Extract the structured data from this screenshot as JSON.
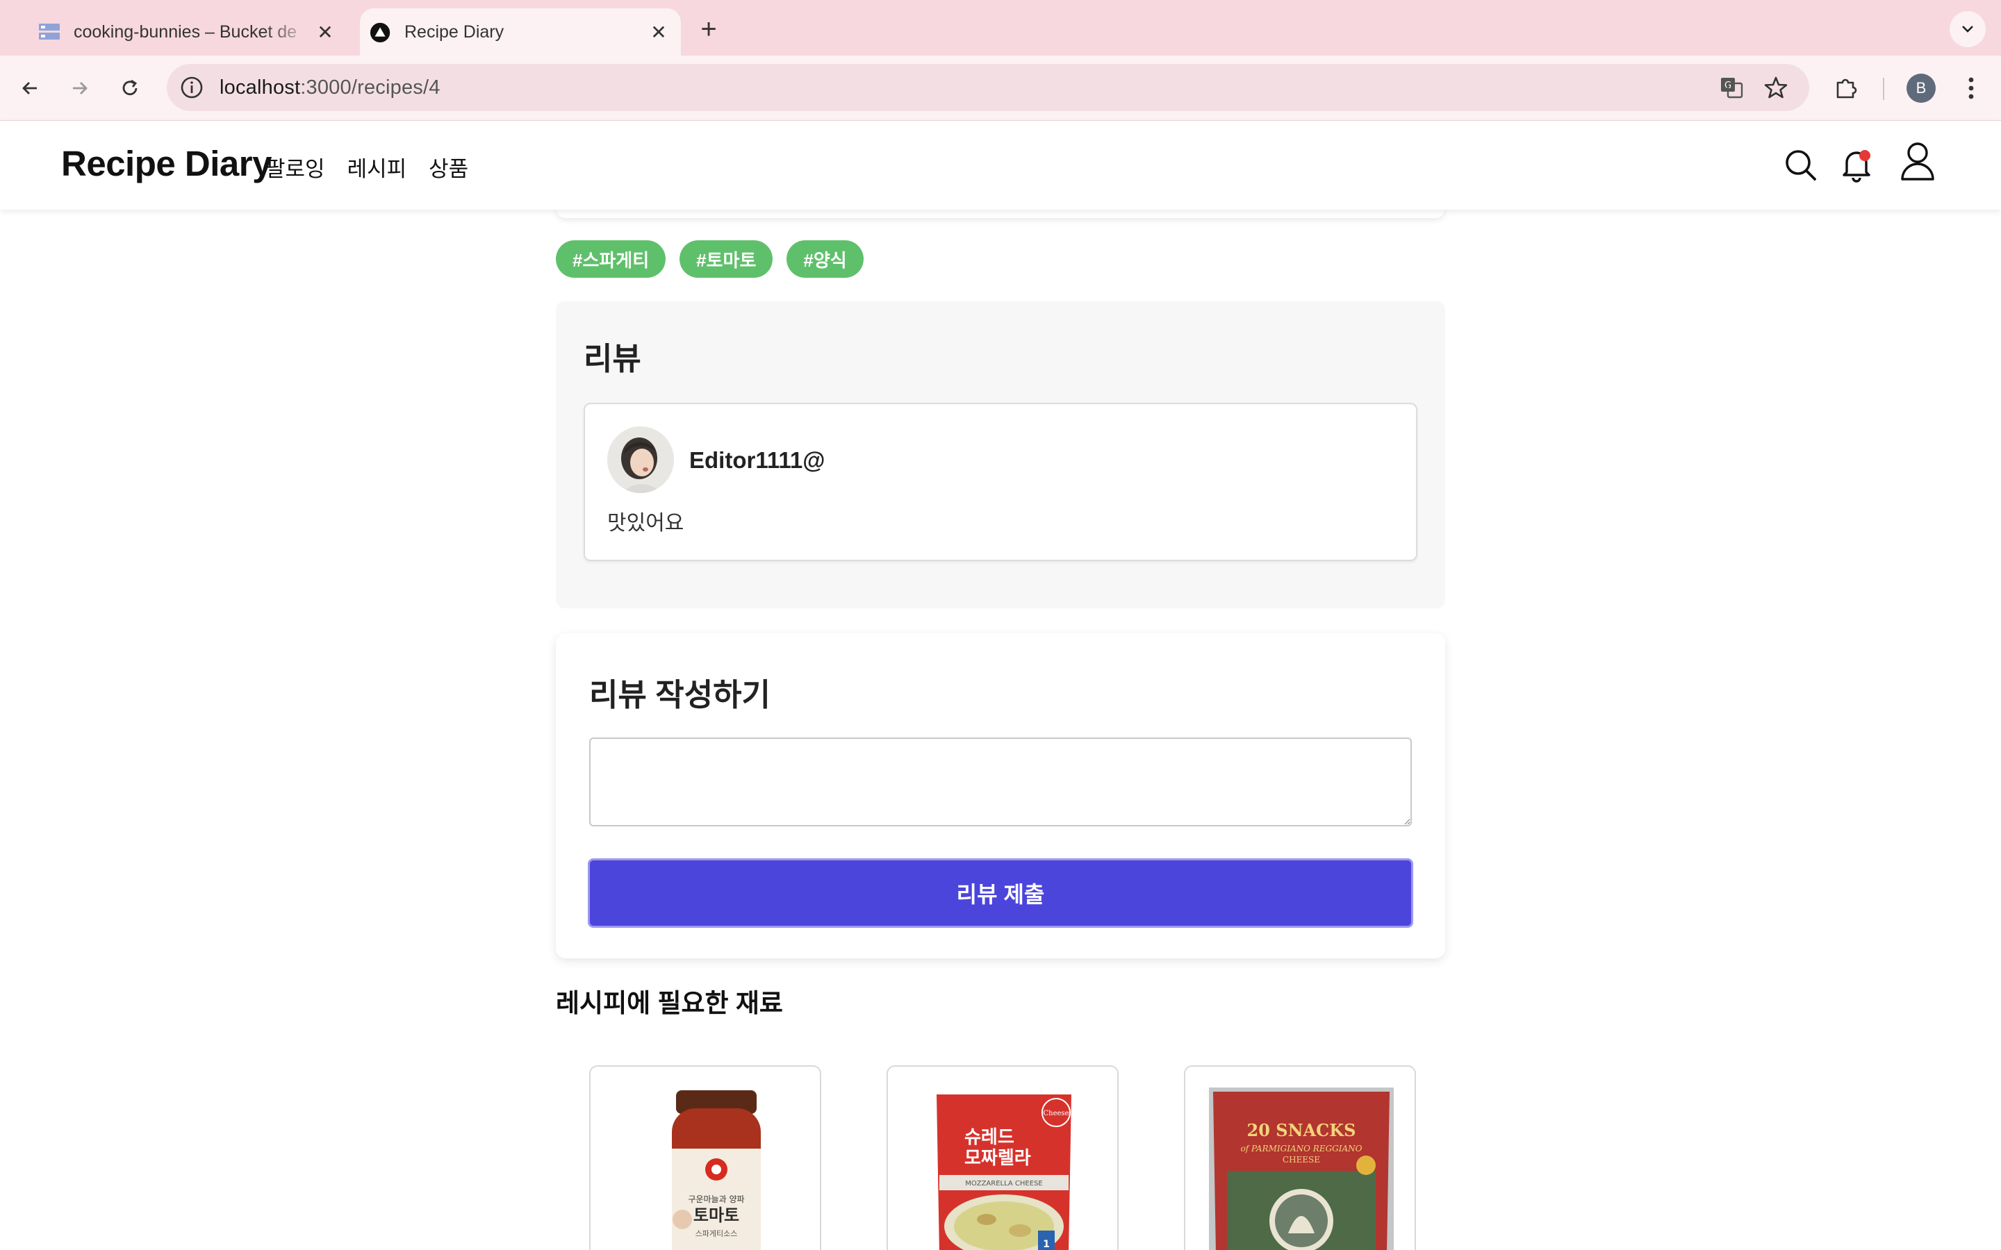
{
  "browser": {
    "tabs": [
      {
        "title": "cooking-bunnies – Bucket de",
        "active": false,
        "favicon": "storage-bucket-icon"
      },
      {
        "title": "Recipe Diary",
        "active": true,
        "favicon": "triangle-logo-icon"
      }
    ],
    "url_host": "localhost",
    "url_path": ":3000/recipes/4",
    "profile_initial": "B"
  },
  "header": {
    "brand": "Recipe Diary",
    "nav": [
      "팔로잉",
      "레시피",
      "상품"
    ],
    "notification_dot_color": "#e53935"
  },
  "tags": [
    "#스파게티",
    "#토마토",
    "#양식"
  ],
  "reviews": {
    "title": "리뷰",
    "items": [
      {
        "author": "Editor1111@",
        "text": "맛있어요"
      }
    ]
  },
  "write_review": {
    "title": "리뷰 작성하기",
    "textarea_value": "",
    "submit_label": "리뷰 제출"
  },
  "ingredients": {
    "title": "레시피에 필요한 재료",
    "products": [
      {
        "name": "tomato-pasta-sauce",
        "image": "tomato-sauce-jar",
        "label_text": "토마토"
      },
      {
        "name": "shredded-mozzarella",
        "image": "mozzarella-bag",
        "label_text": "슈레드 모짜렐라"
      },
      {
        "name": "parmigiano-snacks",
        "image": "parmigiano-snack-bag",
        "label_text": "20 SNACKS"
      }
    ]
  },
  "colors": {
    "accent": "#4b45dc",
    "tag": "#5fc06b",
    "tabbar": "#f7d8de"
  }
}
